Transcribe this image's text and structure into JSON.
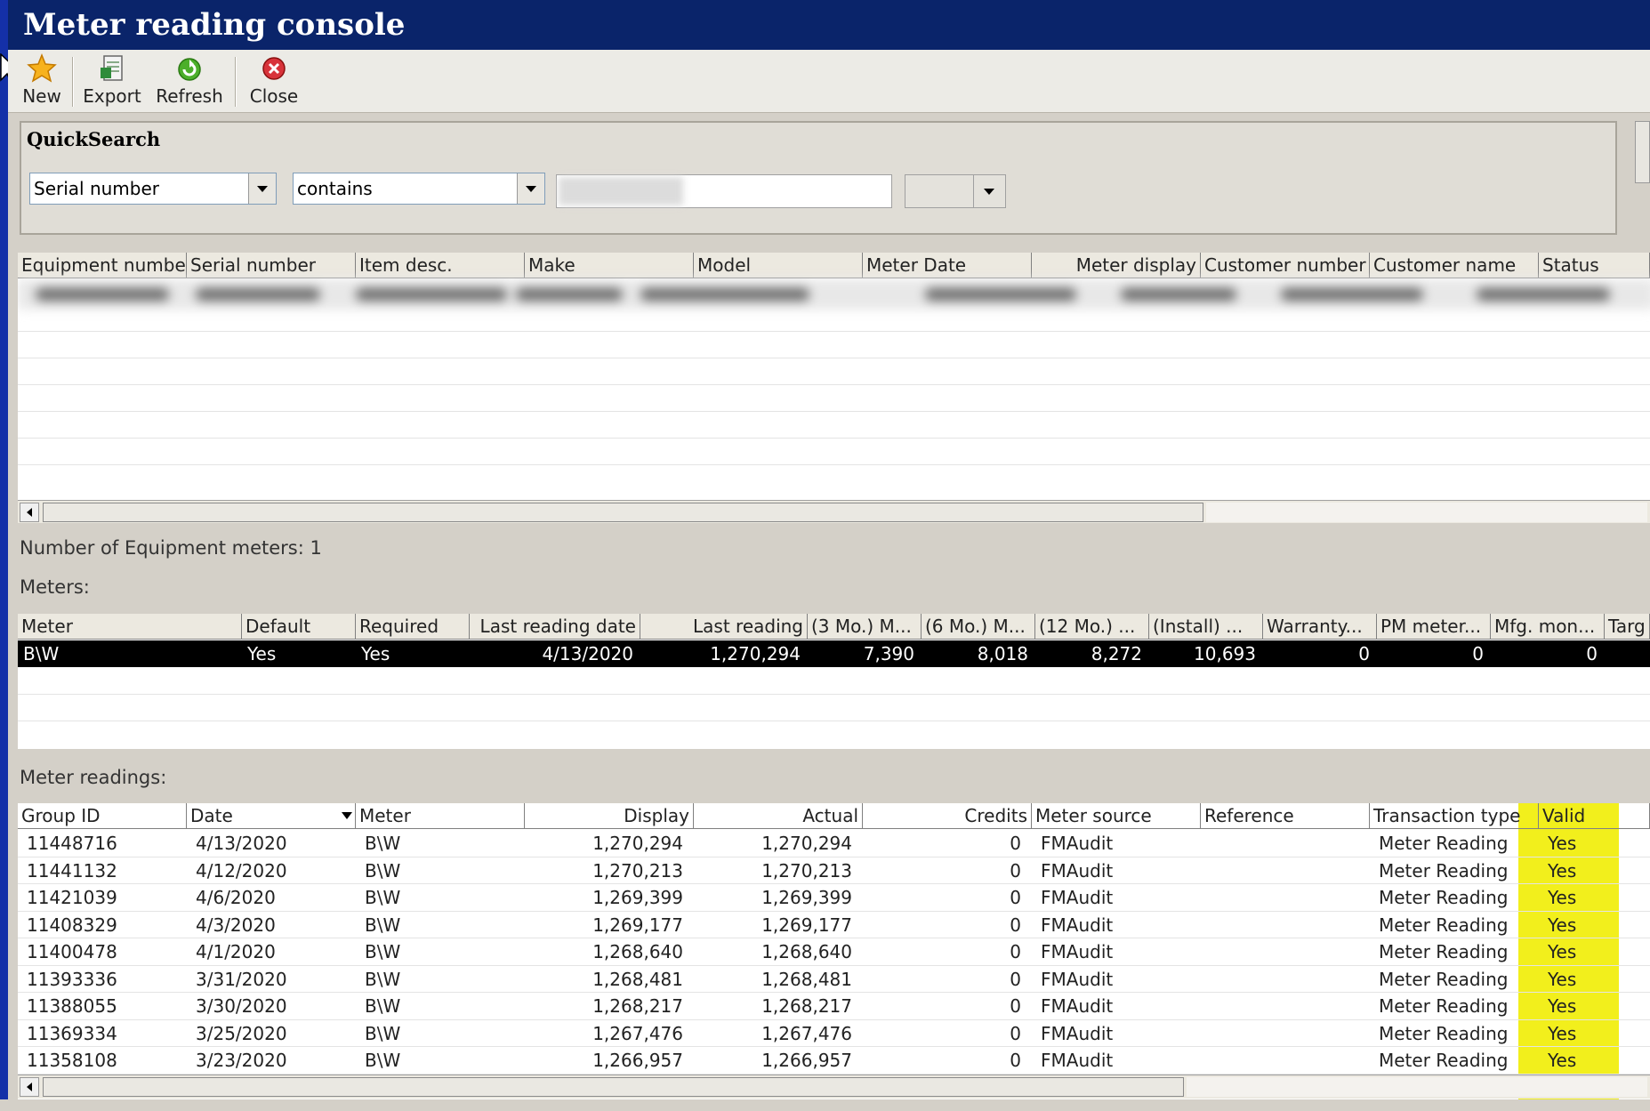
{
  "window": {
    "title": "Meter reading console"
  },
  "toolbar": {
    "new": "New",
    "export": "Export",
    "refresh": "Refresh",
    "close": "Close"
  },
  "quicksearch": {
    "title": "QuickSearch",
    "field": "Serial number",
    "operator": "contains",
    "value": ""
  },
  "equipment_grid": {
    "columns": [
      "Equipment number",
      "Serial number",
      "Item desc.",
      "Make",
      "Model",
      "Meter Date",
      "Meter display",
      "Customer number",
      "Customer name",
      "Status"
    ]
  },
  "equipment_count_label": "Number of Equipment meters: 1",
  "meters": {
    "label": "Meters:",
    "columns": [
      "Meter",
      "Default",
      "Required",
      "Last reading date",
      "Last reading",
      "(3 Mo.) M...",
      "(6 Mo.) M...",
      "(12 Mo.) ...",
      "(Install) ...",
      "Warranty...",
      "PM meter...",
      "Mfg. mon...",
      "Targ"
    ],
    "rows": [
      [
        "B\\W",
        "Yes",
        "Yes",
        "4/13/2020",
        "1,270,294",
        "7,390",
        "8,018",
        "8,272",
        "10,693",
        "0",
        "0",
        "0",
        ""
      ]
    ]
  },
  "readings": {
    "label": "Meter readings:",
    "columns": [
      "Group ID",
      "Date",
      "Meter",
      "Display",
      "Actual",
      "Credits",
      "Meter source",
      "Reference",
      "Transaction type",
      "Valid"
    ],
    "rows": [
      [
        "11448716",
        "4/13/2020",
        "B\\W",
        "1,270,294",
        "1,270,294",
        "0",
        "FMAudit",
        "",
        "Meter Reading",
        "Yes"
      ],
      [
        "11441132",
        "4/12/2020",
        "B\\W",
        "1,270,213",
        "1,270,213",
        "0",
        "FMAudit",
        "",
        "Meter Reading",
        "Yes"
      ],
      [
        "11421039",
        "4/6/2020",
        "B\\W",
        "1,269,399",
        "1,269,399",
        "0",
        "FMAudit",
        "",
        "Meter Reading",
        "Yes"
      ],
      [
        "11408329",
        "4/3/2020",
        "B\\W",
        "1,269,177",
        "1,269,177",
        "0",
        "FMAudit",
        "",
        "Meter Reading",
        "Yes"
      ],
      [
        "11400478",
        "4/1/2020",
        "B\\W",
        "1,268,640",
        "1,268,640",
        "0",
        "FMAudit",
        "",
        "Meter Reading",
        "Yes"
      ],
      [
        "11393336",
        "3/31/2020",
        "B\\W",
        "1,268,481",
        "1,268,481",
        "0",
        "FMAudit",
        "",
        "Meter Reading",
        "Yes"
      ],
      [
        "11388055",
        "3/30/2020",
        "B\\W",
        "1,268,217",
        "1,268,217",
        "0",
        "FMAudit",
        "",
        "Meter Reading",
        "Yes"
      ],
      [
        "11369334",
        "3/25/2020",
        "B\\W",
        "1,267,476",
        "1,267,476",
        "0",
        "FMAudit",
        "",
        "Meter Reading",
        "Yes"
      ],
      [
        "11358108",
        "3/23/2020",
        "B\\W",
        "1,266,957",
        "1,266,957",
        "0",
        "FMAudit",
        "",
        "Meter Reading",
        "Yes"
      ]
    ]
  },
  "colors": {
    "title_bar": "#0a246a",
    "selection": "#000000",
    "valid_highlight": "#f2ef1c"
  }
}
